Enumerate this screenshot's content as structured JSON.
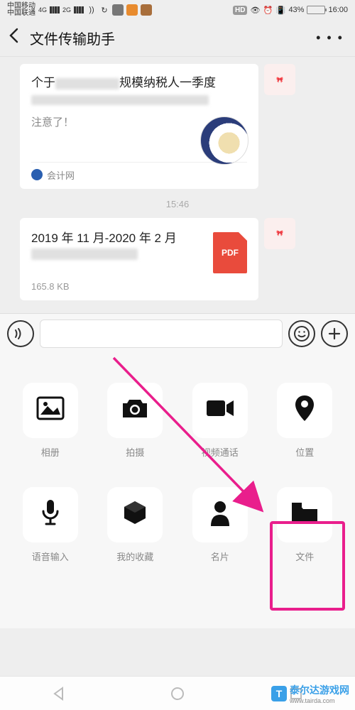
{
  "statusbar": {
    "carrier1": "中国移动",
    "carrier2": "中国联通",
    "net": "4G",
    "net2": "2G",
    "hd": "HD",
    "battery_pct": "43%",
    "time": "16:00"
  },
  "header": {
    "title": "文件传输助手"
  },
  "chat": {
    "article": {
      "title_prefix": "个于",
      "title_mid": "规模纳税人一季度",
      "note": "注意了！",
      "source": "会计网"
    },
    "timestamp": "15:46",
    "file": {
      "title": "2019 年 11 月-2020 年 2 月",
      "size": "165.8 KB",
      "badge": "PDF"
    }
  },
  "panel": {
    "items": [
      {
        "label": "相册"
      },
      {
        "label": "拍摄"
      },
      {
        "label": "视频通话"
      },
      {
        "label": "位置"
      },
      {
        "label": "语音输入"
      },
      {
        "label": "我的收藏"
      },
      {
        "label": "名片"
      },
      {
        "label": "文件"
      }
    ]
  },
  "watermark": {
    "text": "泰尔达游戏网",
    "url": "www.tairda.com"
  }
}
